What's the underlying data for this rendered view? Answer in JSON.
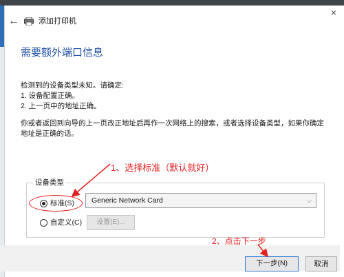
{
  "window": {
    "title": "添加打印机",
    "back_icon": "arrow-left-icon",
    "printer_icon": "printer-icon",
    "close_glyph": "×"
  },
  "page": {
    "heading": "需要额外端口信息",
    "intro": "检测到的设备类型未知。请确定:",
    "item1": "1. 设备配置正确。",
    "item2": "2. 上一页中的地址正确。",
    "hint": "你或者返回到向导的上一页改正地址后再作一次网络上的搜索，或者选择设备类型，如果你确定地址是正确的话。"
  },
  "device_type": {
    "group_label": "设备类型",
    "standard_label": "标准(S)",
    "standard_selected": true,
    "standard_value": "Generic Network Card",
    "custom_label": "自定义(C)",
    "custom_selected": false,
    "settings_button": "设置(E)..."
  },
  "footer": {
    "next_button": "下一步(N)",
    "cancel_button": "取消"
  },
  "annotations": {
    "note1": "1、选择标准（默认就好）",
    "note2": "2、点击下一步",
    "color": "#e02020"
  },
  "colors": {
    "heading": "#1f4ea0",
    "focus_border": "#2b79d6"
  }
}
